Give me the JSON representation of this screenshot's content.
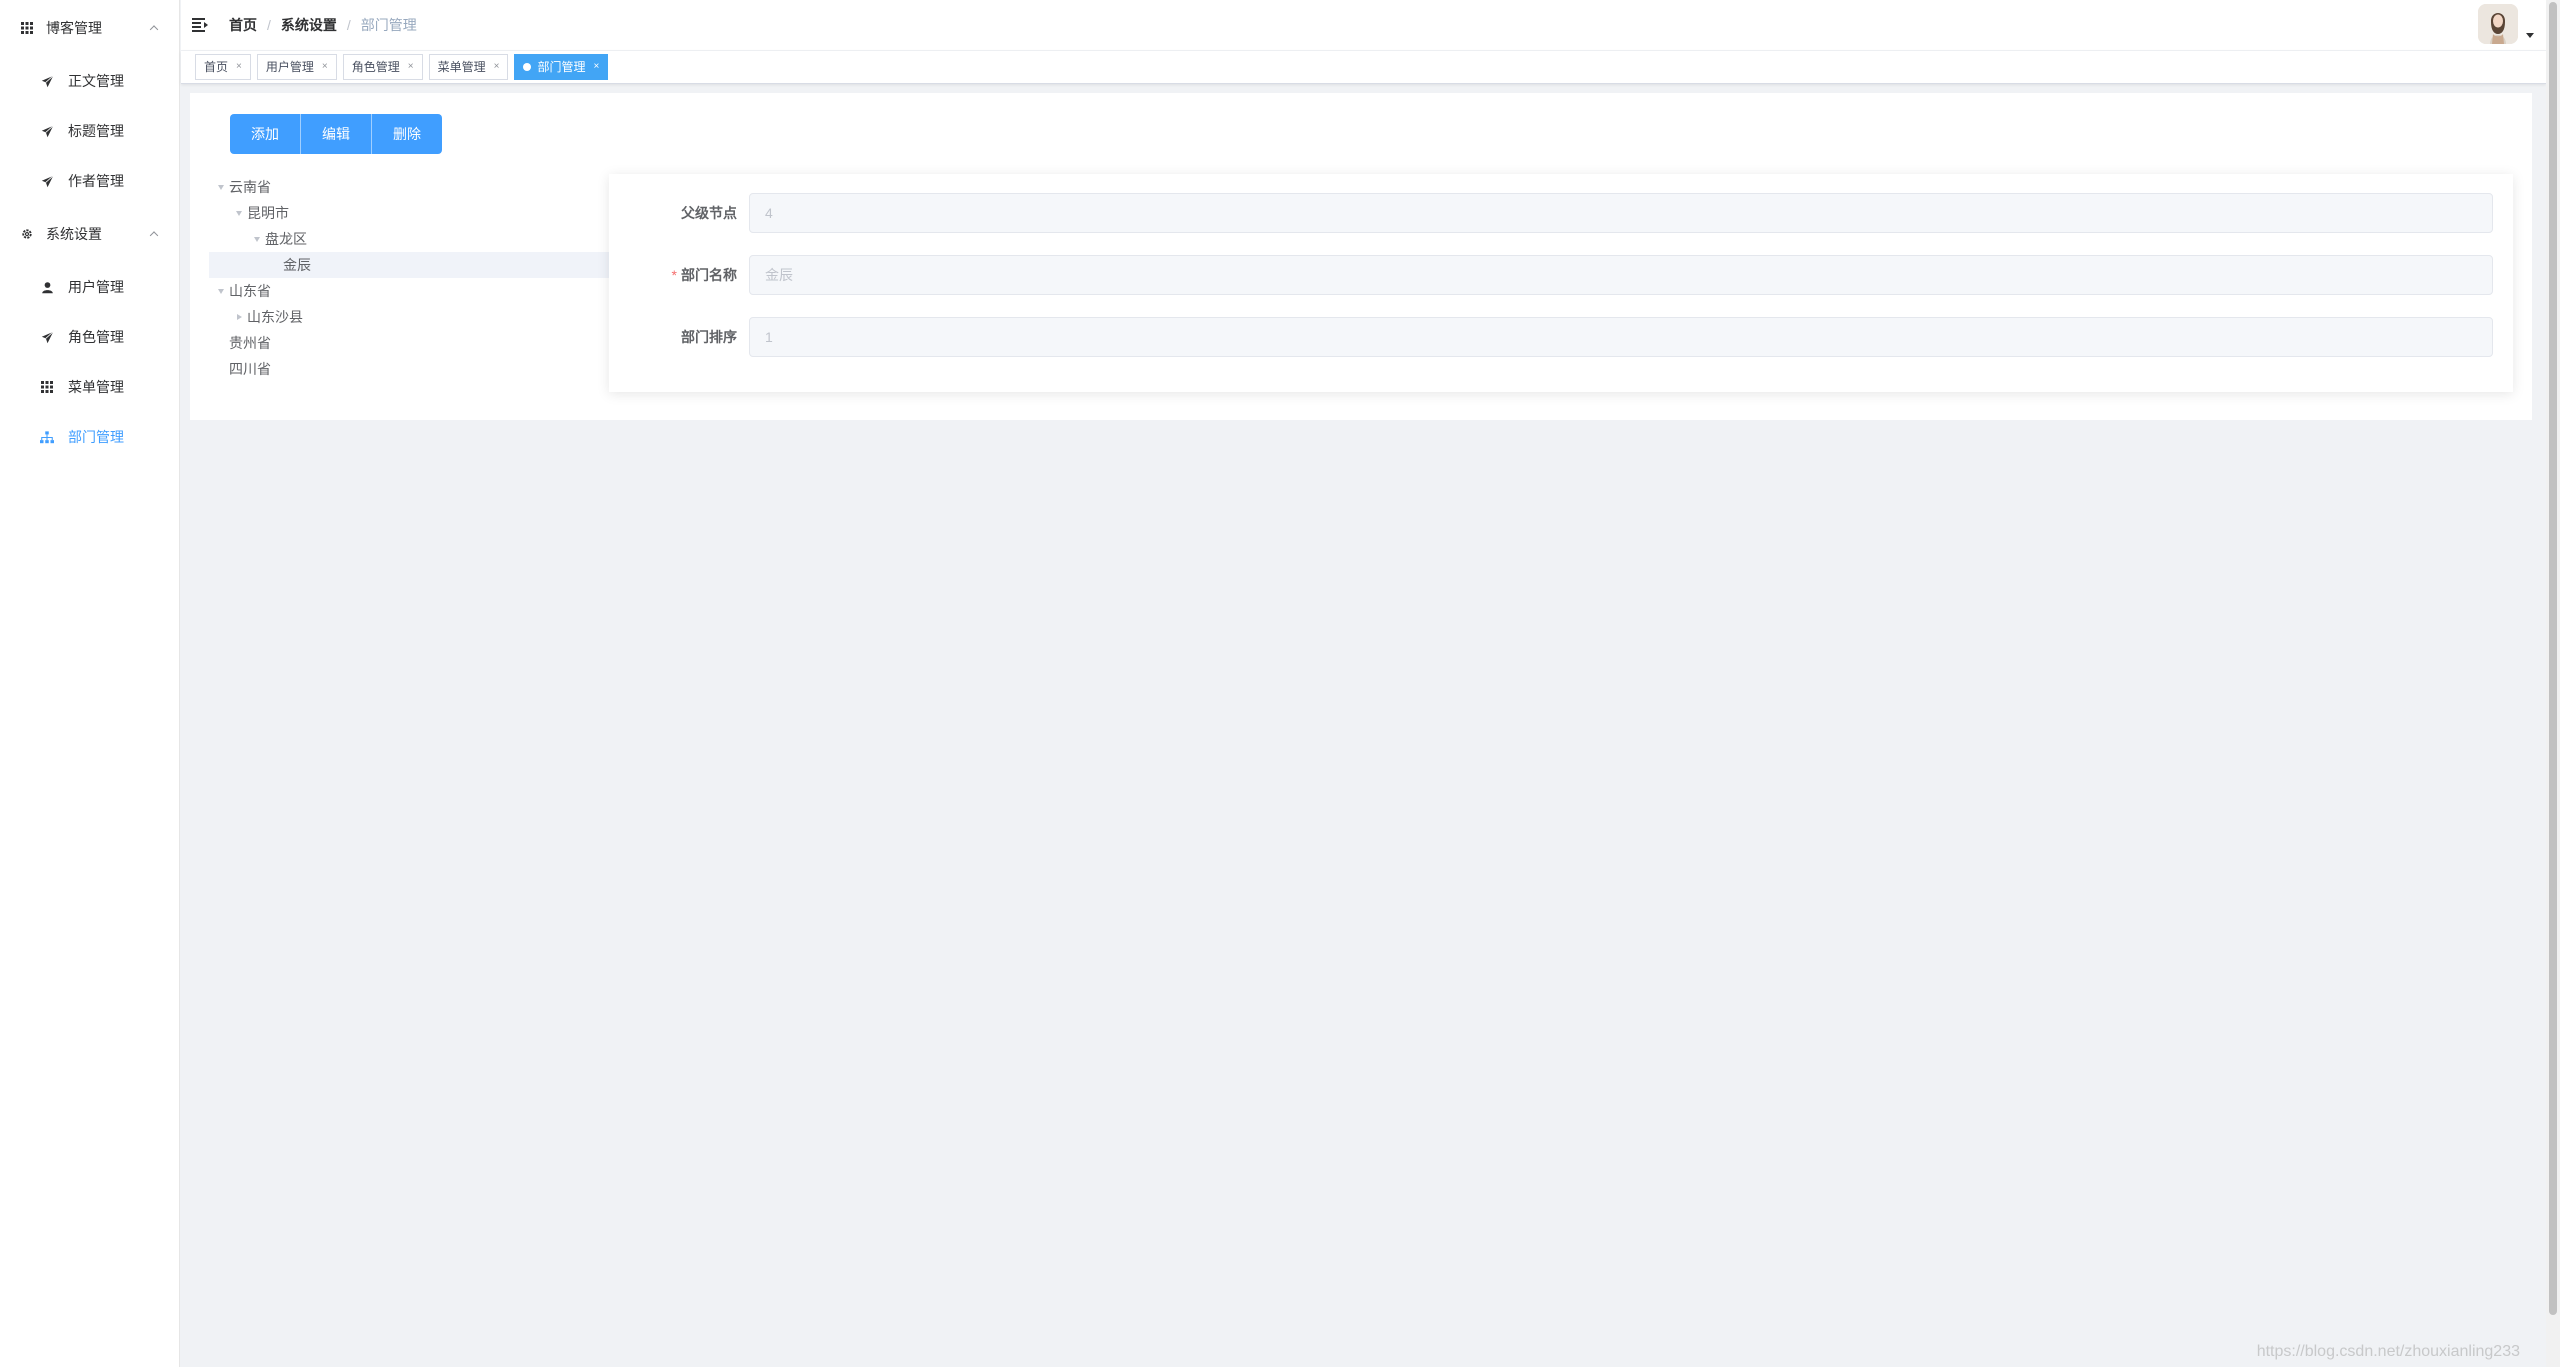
{
  "sidebar": {
    "groups": [
      {
        "label": "博客管理",
        "icon": "grid-icon",
        "items": [
          {
            "label": "正文管理",
            "icon": "paper-plane-icon"
          },
          {
            "label": "标题管理",
            "icon": "paper-plane-icon"
          },
          {
            "label": "作者管理",
            "icon": "paper-plane-icon"
          }
        ]
      },
      {
        "label": "系统设置",
        "icon": "gear-icon",
        "items": [
          {
            "label": "用户管理",
            "icon": "user-icon"
          },
          {
            "label": "角色管理",
            "icon": "paper-plane-icon"
          },
          {
            "label": "菜单管理",
            "icon": "grid-icon"
          },
          {
            "label": "部门管理",
            "icon": "org-tree-icon",
            "active": true
          }
        ]
      }
    ]
  },
  "header": {
    "breadcrumb": [
      "首页",
      "系统设置",
      "部门管理"
    ]
  },
  "tags": [
    {
      "label": "首页"
    },
    {
      "label": "用户管理"
    },
    {
      "label": "角色管理"
    },
    {
      "label": "菜单管理"
    },
    {
      "label": "部门管理",
      "active": true
    }
  ],
  "toolbar": {
    "add_label": "添加",
    "edit_label": "编辑",
    "delete_label": "删除"
  },
  "tree": {
    "nodes": [
      {
        "label": "云南省",
        "level": 0,
        "expander": "down"
      },
      {
        "label": "昆明市",
        "level": 1,
        "expander": "down"
      },
      {
        "label": "盘龙区",
        "level": 2,
        "expander": "down"
      },
      {
        "label": "金辰",
        "level": 3,
        "expander": "none",
        "current": true
      },
      {
        "label": "山东省",
        "level": 0,
        "expander": "down"
      },
      {
        "label": "山东沙县",
        "level": 1,
        "expander": "right"
      },
      {
        "label": "贵州省",
        "level": 0,
        "expander": "none"
      },
      {
        "label": "四川省",
        "level": 0,
        "expander": "none"
      }
    ]
  },
  "form": {
    "parent_label": "父级节点",
    "parent_value": "4",
    "name_label": "部门名称",
    "name_value": "金辰",
    "name_required": "*",
    "sort_label": "部门排序",
    "sort_value": "1"
  },
  "watermark": "https://blog.csdn.net/zhouxianling233"
}
